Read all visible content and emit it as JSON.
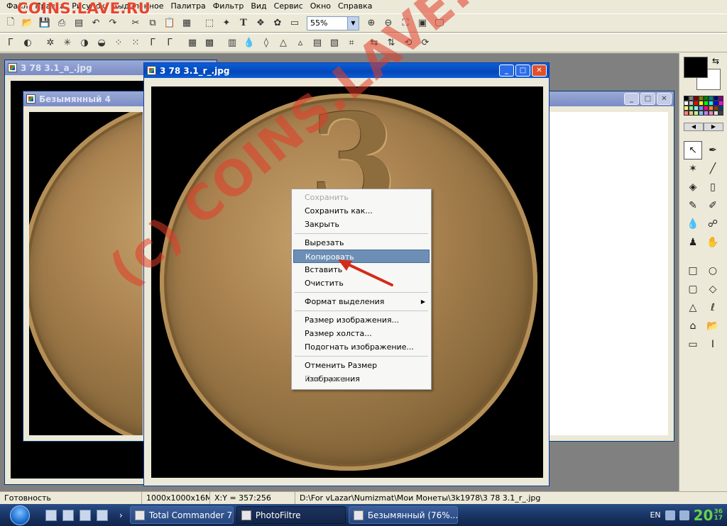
{
  "menu": [
    "Файл",
    "Правка",
    "Рисунок",
    "Выделенное",
    "Палитра",
    "Фильтр",
    "Вид",
    "Сервис",
    "Окно",
    "Справка"
  ],
  "watermark_logo": "COINS.LAVE.RU",
  "toolbar": {
    "zoom_value": "55%"
  },
  "windows": {
    "back_title": "3 78 3.1_a_.jpg",
    "middle_title": "Безымянный 4",
    "active_title": "3 78 3.1_r_.jpg",
    "coin_numeral": "3"
  },
  "context_menu": {
    "items": [
      {
        "label": "Сохранить",
        "disabled": true
      },
      {
        "label": "Сохранить как..."
      },
      {
        "label": "Закрыть"
      },
      {
        "sep": true
      },
      {
        "label": "Вырезать"
      },
      {
        "label": "Копировать",
        "highlighted": true
      },
      {
        "label": "Вставить"
      },
      {
        "label": "Очистить"
      },
      {
        "sep": true
      },
      {
        "label": "Формат выделения",
        "submenu": true
      },
      {
        "sep": true
      },
      {
        "label": "Размер изображения..."
      },
      {
        "label": "Размер холста..."
      },
      {
        "label": "Подогнать изображение..."
      },
      {
        "sep": true
      },
      {
        "label": "Отменить Размер изображения"
      },
      {
        "label": "Повторить",
        "disabled": true
      }
    ]
  },
  "watermark_overlay": "(c) COINS.LAVE.RU",
  "status": {
    "ready": "Готовность",
    "dims": "1000x1000x16M",
    "coords": "X:Y = 357:256",
    "path": "D:\\For vLazar\\Numizmat\\Мои Монеты\\3k1978\\3 78 3.1_r_.jpg"
  },
  "taskbar": {
    "tasks": [
      "Total Commander 7...",
      "PhotoFiltre",
      "Безымянный (76%..."
    ],
    "lang": "EN",
    "clock_hours": "20",
    "clock_min": "36",
    "clock_sec": "17"
  },
  "colors": {
    "accent": "#e8442e",
    "highlight": "#6d8fb5",
    "clock": "#66d14a"
  }
}
